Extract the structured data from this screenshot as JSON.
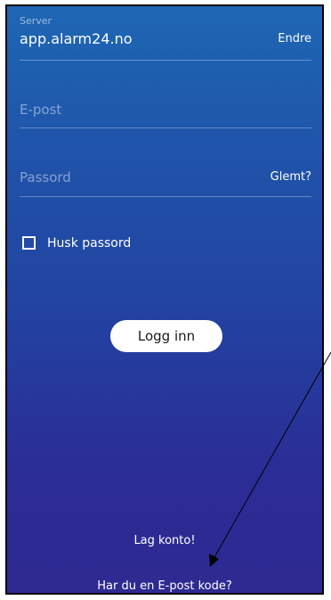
{
  "server": {
    "label": "Server",
    "value": "app.alarm24.no",
    "action_label": "Endre"
  },
  "email": {
    "placeholder": "E-post",
    "value": ""
  },
  "password": {
    "placeholder": "Passord",
    "value": "",
    "forgot_label": "Glemt?"
  },
  "remember": {
    "label": "Husk passord",
    "checked": false
  },
  "login_button": {
    "label": "Logg inn"
  },
  "create_account": {
    "label": "Lag konto!"
  },
  "email_code": {
    "label": "Har du en E-post kode?"
  },
  "colors": {
    "gradient_top": "#1e67b4",
    "gradient_bottom": "#2e2a92",
    "text": "#ffffff",
    "button_bg": "#ffffff"
  },
  "icons": {
    "checkbox": "checkbox-unchecked-icon",
    "annotation": "annotation-arrow-icon"
  }
}
